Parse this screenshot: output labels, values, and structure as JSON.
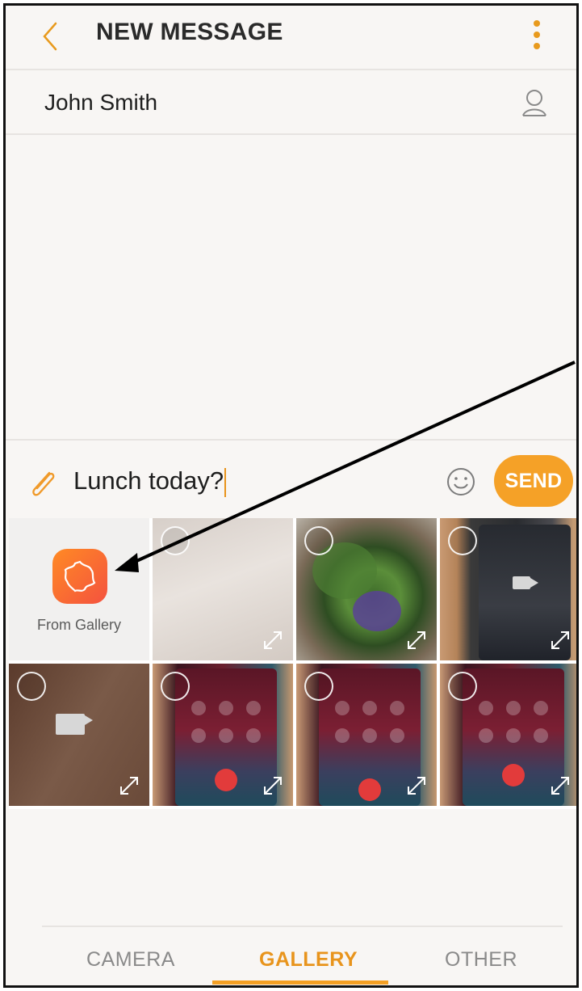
{
  "header": {
    "title": "NEW MESSAGE"
  },
  "recipient": {
    "name": "John Smith"
  },
  "compose": {
    "message_text": "Lunch today?",
    "send_label": "SEND"
  },
  "gallery": {
    "from_gallery_label": "From Gallery"
  },
  "tabs": [
    {
      "label": "CAMERA",
      "active": false
    },
    {
      "label": "GALLERY",
      "active": true
    },
    {
      "label": "OTHER",
      "active": false
    }
  ],
  "colors": {
    "accent": "#f5a127",
    "active_tab": "#e8941c",
    "background": "#f8f6f4"
  }
}
